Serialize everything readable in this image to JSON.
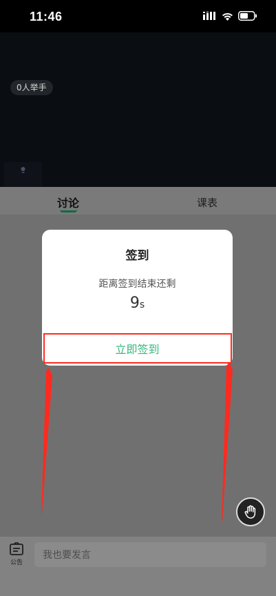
{
  "status_bar": {
    "time": "11:46",
    "icons": [
      "signal-icon",
      "wifi-icon",
      "battery-icon"
    ]
  },
  "video": {
    "raise_hand_count": "0人举手"
  },
  "tabs": [
    {
      "label": "讨论",
      "active": true
    },
    {
      "label": "课表",
      "active": false
    }
  ],
  "modal": {
    "title": "签到",
    "message": "距离签到结束还剩",
    "countdown_value": "9",
    "countdown_unit": "s",
    "action_label": "立即签到"
  },
  "bottom_bar": {
    "notice_label": "公告",
    "input_placeholder": "我也要发言"
  },
  "colors": {
    "accent_green": "#35b77f",
    "highlight_red": "#ff2a1f",
    "tab_indicator": "#0d6b45"
  }
}
